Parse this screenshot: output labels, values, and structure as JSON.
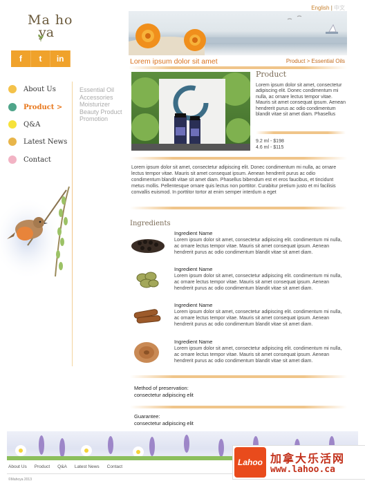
{
  "brand": {
    "logo_line1": "Ma ho",
    "logo_line2": "ya"
  },
  "language": {
    "english": "English",
    "separator": "|",
    "chinese": "中文"
  },
  "social": [
    "f",
    "t",
    "in"
  ],
  "nav": [
    {
      "label": "About Us",
      "color": "#f4c24a"
    },
    {
      "label": "Product >",
      "color": "#4fa58a"
    },
    {
      "label": "Q&A",
      "color": "#f6e23a"
    },
    {
      "label": "Latest News",
      "color": "#e8b54a"
    },
    {
      "label": "Contact",
      "color": "#f2b3c4"
    }
  ],
  "subnav": [
    "Essential Oil",
    "Accessories",
    "Moisturizer",
    "Beauty Product",
    "Promotion"
  ],
  "page": {
    "title": "Lorem ipsum dolor sit amet",
    "breadcrumb": "Product > Essential Oils"
  },
  "product": {
    "heading": "Product",
    "description": "Lorem ipsum dolor sit amet, consectetur adipiscing elit. Donec condimentum mi nulla, ac ornare lectus tempor vitae. Mauris sit amet consequat ipsum. Aenean hendrerit purus ac odio condimentum blandit vitae sit amet diam. Phasellus",
    "prices": [
      "9.2 ml - $198",
      "4.6 ml - $115"
    ],
    "long_description": "Lorem ipsum dolor sit amet, consectetur adipiscing elit. Donec condimentum mi nulla, ac ornare lectus tempor vitae. Mauris sit amet consequat ipsum. Aenean hendrerit purus ac odio condimentum blandit vitae sit amet diam. Phasellus bibendum est et eros faucibus, et tincidunt metus mollis. Pellentesque ornare quis lectus non porttitor. Curabitur pretium justo et mi facilisis convallis euismod. In porttitor tortor at enim semper interdum a eget"
  },
  "ingredients": {
    "heading": "Ingredients",
    "items": [
      {
        "name": "Ingredient Name",
        "text": "Lorem ipsum dolor sit amet, consectetur adipiscing elit. condimentum mi nulla, ac ornare lectus tempor vitae. Mauris sit amet consequat ipsum. Aenean hendrerit purus ac odio condimentum blandit vitae sit amet diam."
      },
      {
        "name": "Ingredient Name",
        "text": "Lorem ipsum dolor sit amet, consectetur adipiscing elit. condimentum mi nulla, ac ornare lectus tempor vitae. Mauris sit amet consequat ipsum. Aenean hendrerit purus ac odio condimentum blandit vitae sit amet diam."
      },
      {
        "name": "Ingredient Name",
        "text": "Lorem ipsum dolor sit amet, consectetur adipiscing elit. condimentum mi nulla, ac ornare lectus tempor vitae. Mauris sit amet consequat ipsum. Aenean hendrerit purus ac odio condimentum blandit vitae sit amet diam."
      },
      {
        "name": "Ingredient Name",
        "text": "Lorem ipsum dolor sit amet, consectetur adipiscing elit. condimentum mi nulla, ac ornare lectus tempor vitae. Mauris sit amet consequat ipsum. Aenean hendrerit purus ac odio condimentum blandit vitae sit amet diam."
      }
    ]
  },
  "preservation": {
    "label": "Method of preservation:",
    "value": "consectetur adipiscing elit"
  },
  "guarantee": {
    "label": "Guarantee:",
    "value": "consectetur adipiscing elit"
  },
  "footer": {
    "links": [
      "About Us",
      "Product",
      "Q&A",
      "Latest News",
      "Contact"
    ],
    "copyright": "©Mahoya 2013"
  },
  "watermark": {
    "logo": "Lahoo",
    "chinese": "加拿大乐活网",
    "url": "www.lahoo.ca"
  }
}
